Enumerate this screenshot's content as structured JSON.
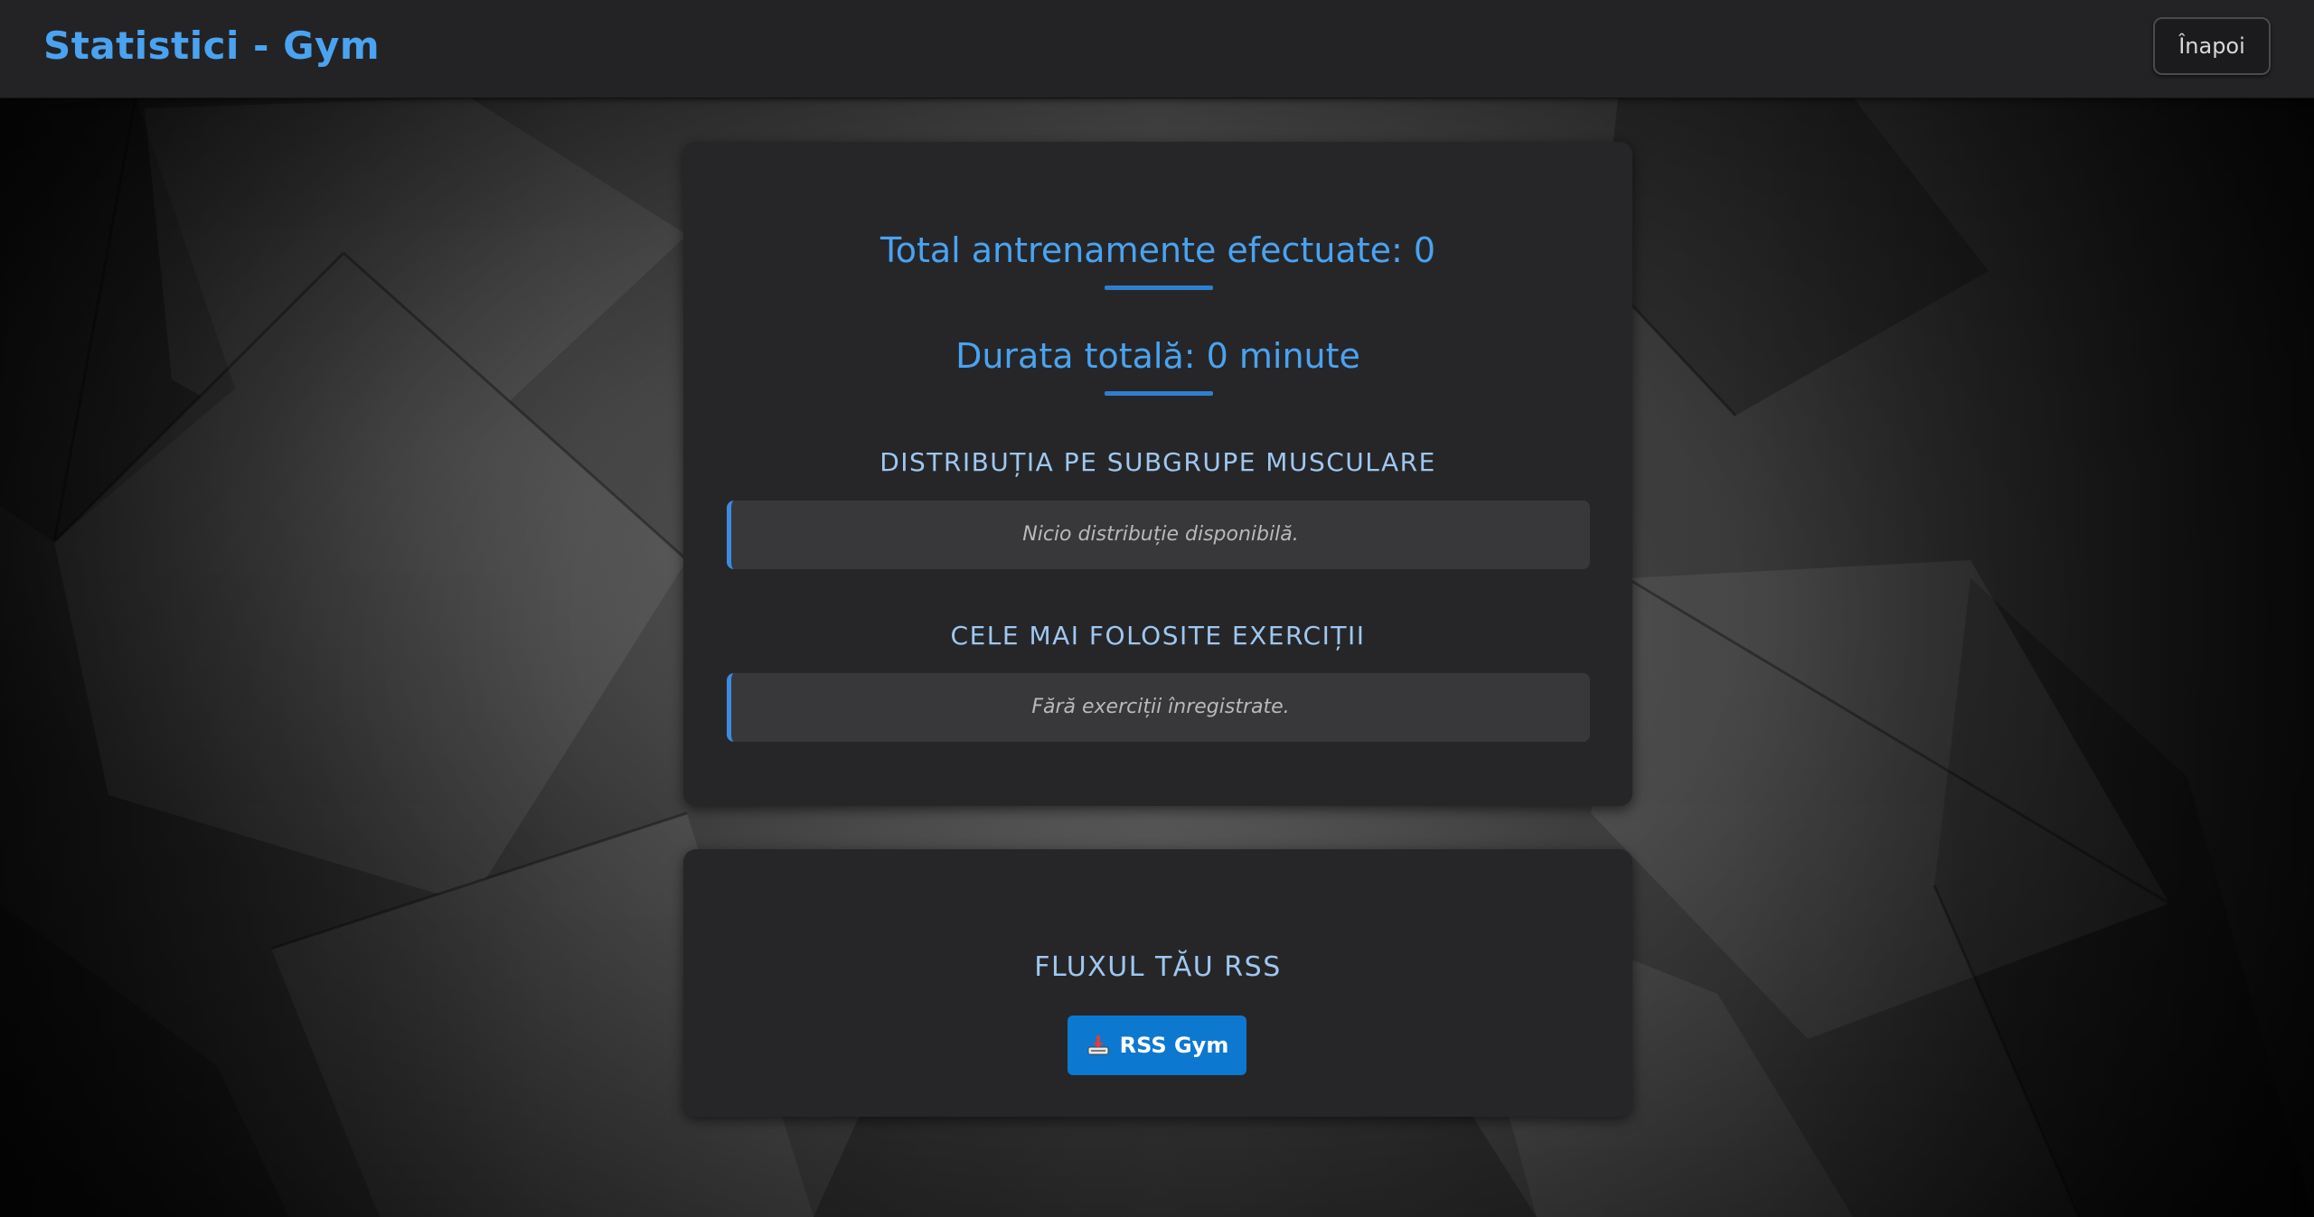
{
  "header": {
    "title": "Statistici - Gym",
    "back_label": "Înapoi"
  },
  "stats": {
    "total_workouts": "Total antrenamente efectuate: 0",
    "total_duration": "Durata totală: 0 minute"
  },
  "distribution": {
    "title": "DISTRIBUȚIA PE SUBGRUPE MUSCULARE",
    "empty_message": "Nicio distribuție disponibilă."
  },
  "exercises": {
    "title": "CELE MAI FOLOSITE EXERCIȚII",
    "empty_message": "Fără exerciții înregistrate."
  },
  "rss": {
    "title": "FLUXUL TĂU RSS",
    "button_label": "RSS Gym",
    "button_icon": "download-tray-icon"
  },
  "colors": {
    "accent": "#4aa3f0",
    "accent_dark": "#2f7fd0",
    "button_blue": "#0d78d0",
    "card_bg": "#262629",
    "header_bg": "#232325"
  }
}
